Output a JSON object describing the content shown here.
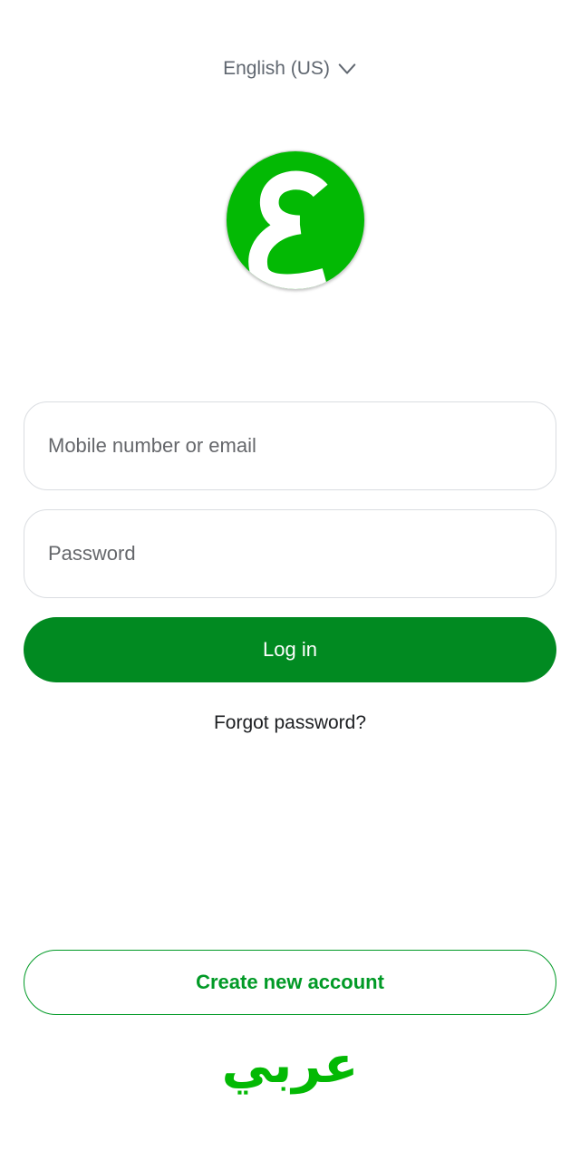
{
  "language": {
    "selected": "English (US)",
    "icon": "chevron-down-icon"
  },
  "logo": {
    "icon": "arabic-ain-letter-logo",
    "accent": "#03b904"
  },
  "login_form": {
    "email_placeholder": "Mobile number or email",
    "email_value": "",
    "password_placeholder": "Password",
    "password_value": "",
    "login_label": "Log in",
    "forgot_label": "Forgot password?"
  },
  "footer": {
    "create_account_label": "Create new account",
    "brand_wordmark": "عربي"
  },
  "colors": {
    "primary": "#018a21",
    "brand_green": "#03b904",
    "outline_green": "#019a26",
    "muted_text": "#606770"
  }
}
